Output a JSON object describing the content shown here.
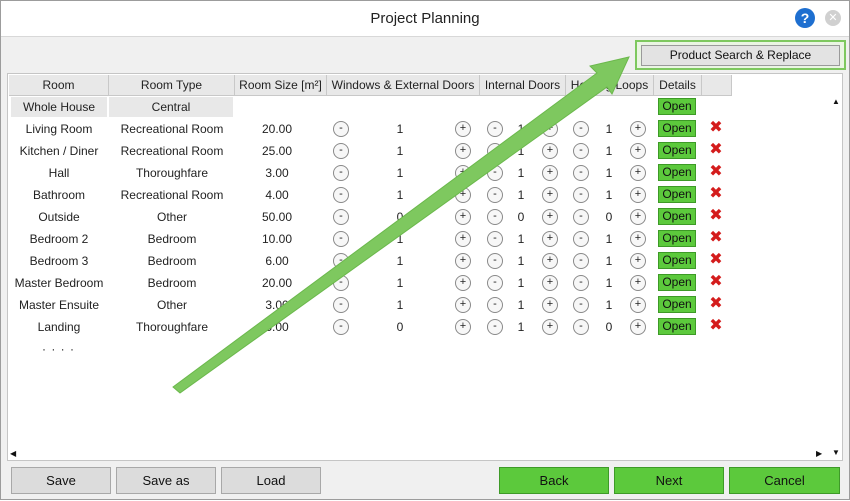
{
  "window": {
    "title": "Project Planning",
    "help_icon": "question-icon",
    "help_glyph": "?",
    "close_icon": "close-icon",
    "close_glyph": "✕"
  },
  "toolbar": {
    "product_search_replace": "Product Search & Replace"
  },
  "table": {
    "headers": [
      "Room",
      "Room Type",
      "Room Size [m²]",
      "Windows & External Doors",
      "Internal Doors",
      "Heating Loops",
      "Details"
    ],
    "summary_row": {
      "room": "Whole House",
      "room_type": "Central",
      "details": "Open"
    },
    "rows": [
      {
        "room": "Living Room",
        "room_type": "Recreational Room",
        "size": "20.00",
        "windows": "1",
        "internal": "1",
        "loops": "1",
        "details": "Open"
      },
      {
        "room": "Kitchen / Diner",
        "room_type": "Recreational Room",
        "size": "25.00",
        "windows": "1",
        "internal": "1",
        "loops": "1",
        "details": "Open"
      },
      {
        "room": "Hall",
        "room_type": "Thoroughfare",
        "size": "3.00",
        "windows": "1",
        "internal": "1",
        "loops": "1",
        "details": "Open"
      },
      {
        "room": "Bathroom",
        "room_type": "Recreational Room",
        "size": "4.00",
        "windows": "1",
        "internal": "1",
        "loops": "1",
        "details": "Open"
      },
      {
        "room": "Outside",
        "room_type": "Other",
        "size": "50.00",
        "windows": "0",
        "internal": "0",
        "loops": "0",
        "details": "Open"
      },
      {
        "room": "Bedroom 2",
        "room_type": "Bedroom",
        "size": "10.00",
        "windows": "1",
        "internal": "1",
        "loops": "1",
        "details": "Open"
      },
      {
        "room": "Bedroom 3",
        "room_type": "Bedroom",
        "size": "6.00",
        "windows": "1",
        "internal": "1",
        "loops": "1",
        "details": "Open"
      },
      {
        "room": "Master Bedroom",
        "room_type": "Bedroom",
        "size": "20.00",
        "windows": "1",
        "internal": "1",
        "loops": "1",
        "details": "Open"
      },
      {
        "room": "Master Ensuite",
        "room_type": "Other",
        "size": "3.00",
        "windows": "1",
        "internal": "1",
        "loops": "1",
        "details": "Open"
      },
      {
        "room": "Landing",
        "room_type": "Thoroughfare",
        "size": "5.00",
        "windows": "0",
        "internal": "1",
        "loops": "0",
        "details": "Open"
      }
    ],
    "more_rows": "· · · ·",
    "minus_glyph": "-",
    "plus_glyph": "+",
    "delete_glyph": "✖",
    "delete_icon": "delete-x-icon"
  },
  "scroll": {
    "up": "▲",
    "down": "▼",
    "left": "◀",
    "right": "▶"
  },
  "footer": {
    "save": "Save",
    "save_as": "Save as",
    "load": "Load",
    "back": "Back",
    "next": "Next",
    "cancel": "Cancel"
  },
  "colors": {
    "accent_green": "#5cc93c",
    "delete_red": "#d41c1c",
    "help_blue": "#1e6fd0",
    "annotation_arrow": "#7ec85f"
  }
}
